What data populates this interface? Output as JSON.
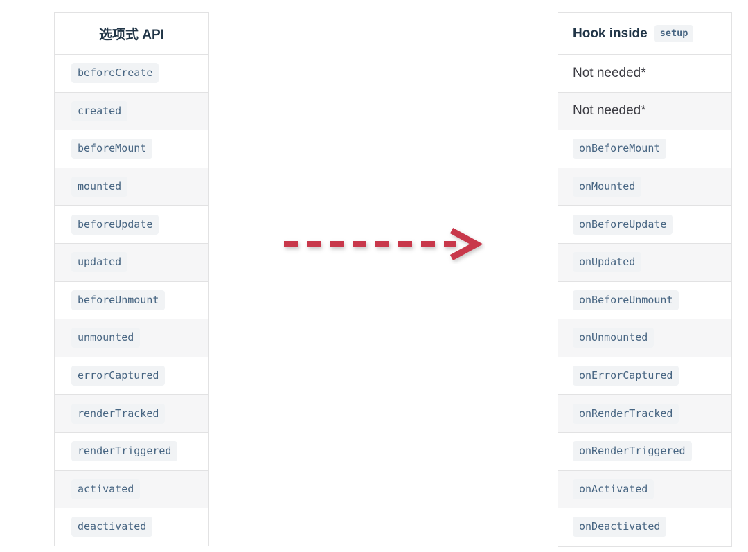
{
  "left_table": {
    "header": "选项式 API",
    "rows": [
      {
        "text": "beforeCreate",
        "kind": "code"
      },
      {
        "text": "created",
        "kind": "code"
      },
      {
        "text": "beforeMount",
        "kind": "code"
      },
      {
        "text": "mounted",
        "kind": "code"
      },
      {
        "text": "beforeUpdate",
        "kind": "code"
      },
      {
        "text": "updated",
        "kind": "code"
      },
      {
        "text": "beforeUnmount",
        "kind": "code"
      },
      {
        "text": "unmounted",
        "kind": "code"
      },
      {
        "text": "errorCaptured",
        "kind": "code"
      },
      {
        "text": "renderTracked",
        "kind": "code"
      },
      {
        "text": "renderTriggered",
        "kind": "code"
      },
      {
        "text": "activated",
        "kind": "code"
      },
      {
        "text": "deactivated",
        "kind": "code"
      }
    ]
  },
  "right_table": {
    "header_text": "Hook inside",
    "header_code": "setup",
    "rows": [
      {
        "text": "Not needed*",
        "kind": "plain"
      },
      {
        "text": "Not needed*",
        "kind": "plain"
      },
      {
        "text": "onBeforeMount",
        "kind": "code"
      },
      {
        "text": "onMounted",
        "kind": "code"
      },
      {
        "text": "onBeforeUpdate",
        "kind": "code"
      },
      {
        "text": "onUpdated",
        "kind": "code"
      },
      {
        "text": "onBeforeUnmount",
        "kind": "code"
      },
      {
        "text": "onUnmounted",
        "kind": "code"
      },
      {
        "text": "onErrorCaptured",
        "kind": "code"
      },
      {
        "text": "onRenderTracked",
        "kind": "code"
      },
      {
        "text": "onRenderTriggered",
        "kind": "code"
      },
      {
        "text": "onActivated",
        "kind": "code"
      },
      {
        "text": "onDeactivated",
        "kind": "code"
      }
    ]
  },
  "arrow": {
    "icon": "dashed-arrow-right-icon",
    "color": "#c8394b",
    "direction": "right",
    "style": "dashed"
  },
  "colors": {
    "border": "#e2e2e3",
    "stripe": "#f6f6f7",
    "code_bg": "#f1f3f5",
    "code_text": "#476582",
    "heading_text": "#213547",
    "body_text": "#3c3c43"
  }
}
